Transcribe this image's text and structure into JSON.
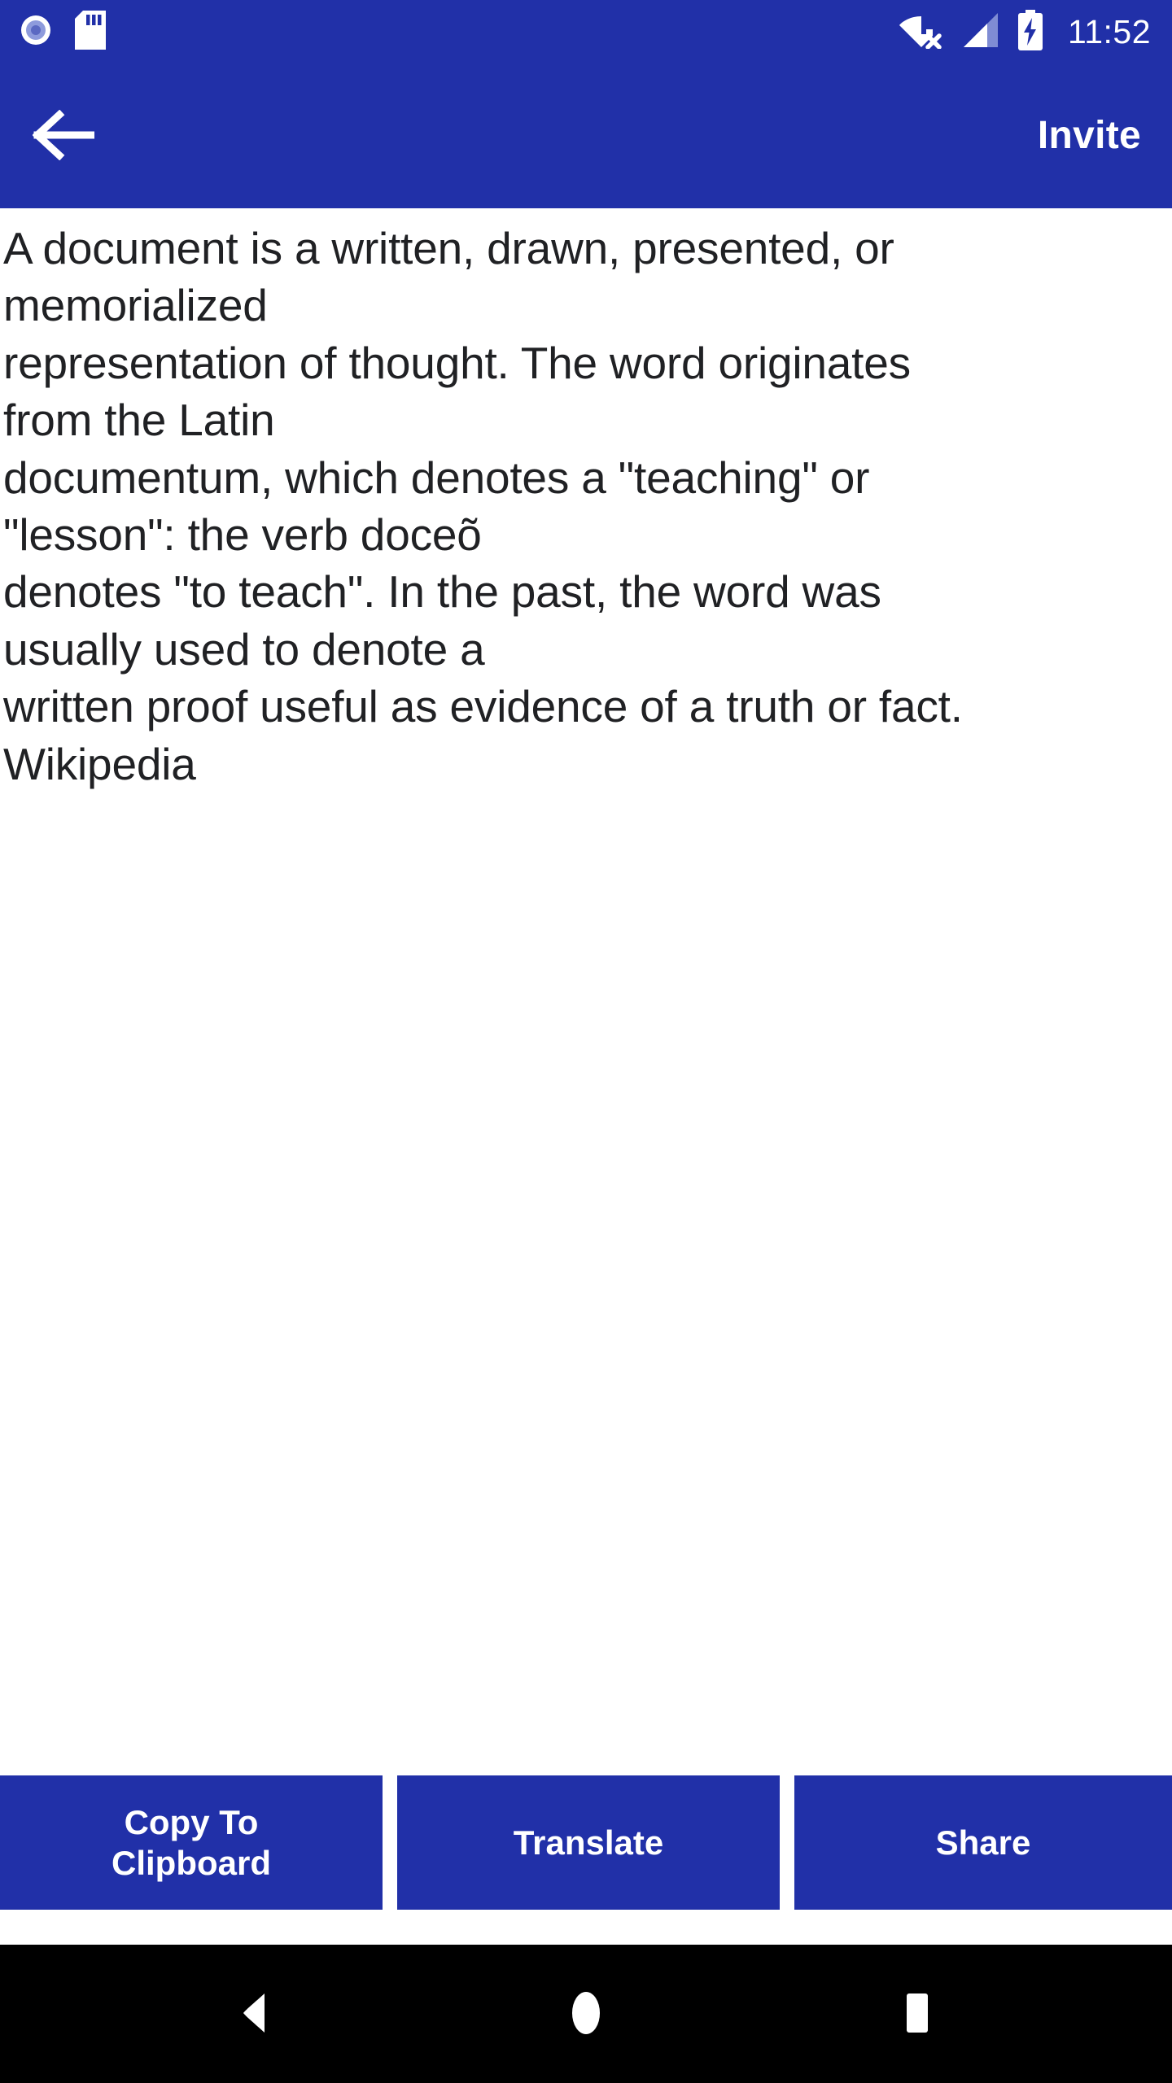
{
  "status_bar": {
    "icons_left": [
      "screen-record-icon",
      "sd-card-icon"
    ],
    "icons_right": [
      "wifi-off-icon",
      "cell-signal-icon",
      "battery-charging-icon"
    ],
    "time": "11:52"
  },
  "app_bar": {
    "back_icon": "back-arrow-icon",
    "action_label": "Invite"
  },
  "content": {
    "definition": "A document is a written, drawn, presented, or\nmemorialized\nrepresentation of thought. The word originates\nfrom the Latin\ndocumentum, which denotes a \"teaching\" or\n\"lesson\": the verb doceõ\ndenotes \"to teach\". In the past, the word was\nusually used to denote a\nwritten proof useful as evidence of a truth or fact.\nWikipedia",
    "source": "Wikipedia"
  },
  "actions": {
    "copy_label": "Copy To\nClipboard",
    "translate_label": "Translate",
    "share_label": "Share"
  },
  "nav_bar": {
    "back": "nav-back-icon",
    "home": "nav-home-icon",
    "recents": "nav-recents-icon"
  },
  "colors": {
    "primary_blue": "#2130A8",
    "text_dark": "#202124",
    "surface": "#FFFFFF",
    "nav_black": "#000000"
  }
}
